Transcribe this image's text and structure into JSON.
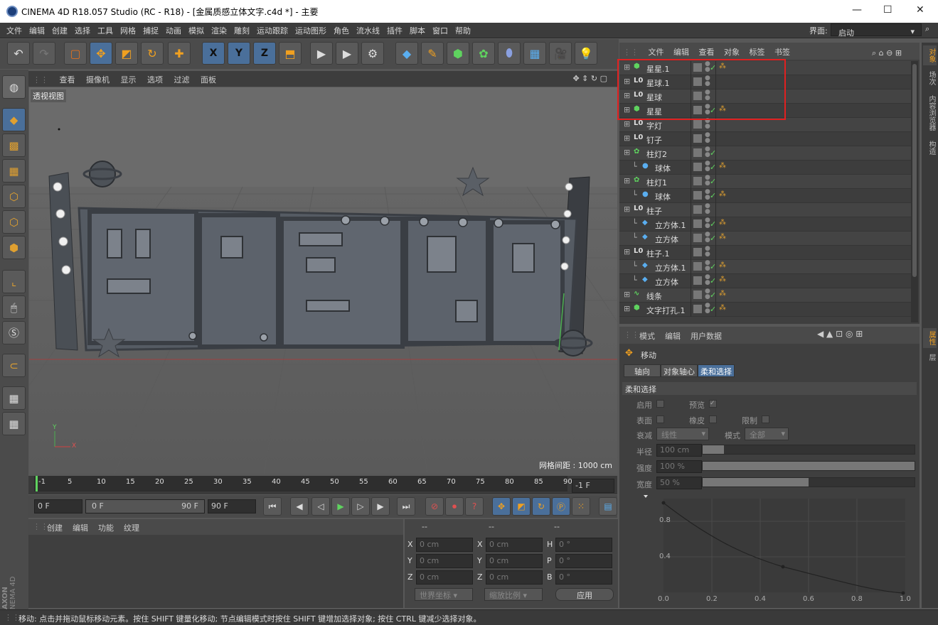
{
  "window": {
    "title": "CINEMA 4D R18.057 Studio (RC - R18) - [金属质感立体文字.c4d *] - 主要",
    "minimize": "—",
    "maximize": "☐",
    "close": "✕"
  },
  "menu": [
    "文件",
    "编辑",
    "创建",
    "选择",
    "工具",
    "网格",
    "捕捉",
    "动画",
    "模拟",
    "渲染",
    "雕刻",
    "运动跟踪",
    "运动图形",
    "角色",
    "流水线",
    "插件",
    "脚本",
    "窗口",
    "帮助"
  ],
  "layout": {
    "label": "界面:",
    "value": "启动"
  },
  "toolbar": {
    "icons": [
      "undo-icon",
      "redo-icon",
      "live-select-icon",
      "move-icon",
      "scale-icon",
      "rotate-icon",
      "add-icon",
      "x-axis-icon",
      "y-axis-icon",
      "z-axis-icon",
      "coordinate-system-icon",
      "render-view-icon",
      "render-picture-viewer-icon",
      "render-settings-icon",
      "cube-icon",
      "pen-icon",
      "subdivision-icon",
      "cloner-icon",
      "deformer-icon",
      "floor-icon",
      "camera-icon",
      "light-icon"
    ],
    "x": "X",
    "y": "Y",
    "z": "Z"
  },
  "viewport": {
    "menu": [
      "查看",
      "摄像机",
      "显示",
      "选项",
      "过滤",
      "面板"
    ],
    "label": "透视视图",
    "grid_text": "网格间距 : 1000 cm",
    "axis": {
      "y": "Y",
      "x": "X"
    }
  },
  "timeline": {
    "ticks": [
      "-1",
      "5",
      "10",
      "15",
      "20",
      "25",
      "30",
      "35",
      "40",
      "45",
      "50",
      "55",
      "60",
      "65",
      "70",
      "75",
      "80",
      "85",
      "90"
    ],
    "current": "-1 F"
  },
  "playback": {
    "start": "0 F",
    "range_start": "0 F",
    "range_end": "90 F",
    "end": "90 F"
  },
  "material": {
    "menu": [
      "创建",
      "编辑",
      "功能",
      "纹理"
    ]
  },
  "coords": {
    "headers": [
      "--",
      "--",
      "--"
    ],
    "rows": [
      {
        "a": "X",
        "av": "0 cm",
        "b": "X",
        "bv": "0 cm",
        "c": "H",
        "cv": "0 °"
      },
      {
        "a": "Y",
        "av": "0 cm",
        "b": "Y",
        "bv": "0 cm",
        "c": "P",
        "cv": "0 °"
      },
      {
        "a": "Z",
        "av": "0 cm",
        "b": "Z",
        "bv": "0 cm",
        "c": "B",
        "cv": "0 °"
      }
    ],
    "world": "世界坐标",
    "scale": "缩放比例",
    "apply": "应用"
  },
  "objects": {
    "menu": [
      "文件",
      "编辑",
      "查看",
      "对象",
      "标签",
      "书签"
    ],
    "items": [
      {
        "name": "星星.1",
        "indent": 0,
        "icon": "sweep",
        "check": "✓",
        "mat": true
      },
      {
        "name": "星球.1",
        "indent": 0,
        "icon": "null",
        "check": "",
        "mat": false
      },
      {
        "name": "星球",
        "indent": 0,
        "icon": "null",
        "check": "",
        "mat": false
      },
      {
        "name": "星星",
        "indent": 0,
        "icon": "sweep",
        "check": "✓",
        "mat": true
      },
      {
        "name": "字灯",
        "indent": 0,
        "icon": "null",
        "check": "",
        "mat": false
      },
      {
        "name": "钉子",
        "indent": 0,
        "icon": "null",
        "check": "",
        "mat": false
      },
      {
        "name": "柱灯2",
        "indent": 0,
        "icon": "cloner",
        "check": "✓",
        "mat": false
      },
      {
        "name": "球体",
        "indent": 1,
        "icon": "sphere",
        "check": "✓",
        "mat": true
      },
      {
        "name": "柱灯1",
        "indent": 0,
        "icon": "cloner",
        "check": "✓",
        "mat": false
      },
      {
        "name": "球体",
        "indent": 1,
        "icon": "sphere",
        "check": "✓",
        "mat": true
      },
      {
        "name": "柱子",
        "indent": 0,
        "icon": "null",
        "check": "",
        "mat": false
      },
      {
        "name": "立方体.1",
        "indent": 1,
        "icon": "cube",
        "check": "✓",
        "mat": true
      },
      {
        "name": "立方体",
        "indent": 1,
        "icon": "cube",
        "check": "✓",
        "mat": true
      },
      {
        "name": "柱子.1",
        "indent": 0,
        "icon": "null",
        "check": "",
        "mat": false
      },
      {
        "name": "立方体.1",
        "indent": 1,
        "icon": "cube",
        "check": "✓",
        "mat": true
      },
      {
        "name": "立方体",
        "indent": 1,
        "icon": "cube",
        "check": "✓",
        "mat": true
      },
      {
        "name": "线条",
        "indent": 0,
        "icon": "spline",
        "check": "✓",
        "mat": true
      },
      {
        "name": "文字打孔.1",
        "indent": 0,
        "icon": "sweep",
        "check": "✓",
        "mat": true
      }
    ]
  },
  "attributes": {
    "menu": [
      "模式",
      "编辑",
      "用户数据"
    ],
    "tool": "移动",
    "tabs": [
      "轴向",
      "对象轴心",
      "柔和选择"
    ],
    "section": "柔和选择",
    "enable": "启用",
    "preview": "预览",
    "surface": "表面",
    "rubber": "橡皮",
    "restrict": "限制",
    "falloff": "衰减",
    "falloff_value": "线性",
    "mode": "模式",
    "mode_value": "全部",
    "radius": "半径",
    "radius_value": "100 cm",
    "strength": "强度",
    "strength_value": "100 %",
    "width": "宽度",
    "width_value": "50 %",
    "graph_y": [
      "0.8",
      "0.4"
    ],
    "graph_x": [
      "0.0",
      "0.2",
      "0.4",
      "0.6",
      "0.8",
      "1.0"
    ]
  },
  "right_tabs_top": [
    "对象",
    "场次",
    "内容浏览器",
    "构造"
  ],
  "right_tabs_bottom": [
    "属性",
    "层"
  ],
  "status": "移动: 点击并拖动鼠标移动元素。按住 SHIFT 键量化移动; 节点编辑模式时按住 SHIFT 键增加选择对象; 按住 CTRL 键减少选择对象。",
  "brand": {
    "line1": "MAXON",
    "line2": "CINEMA 4D"
  }
}
